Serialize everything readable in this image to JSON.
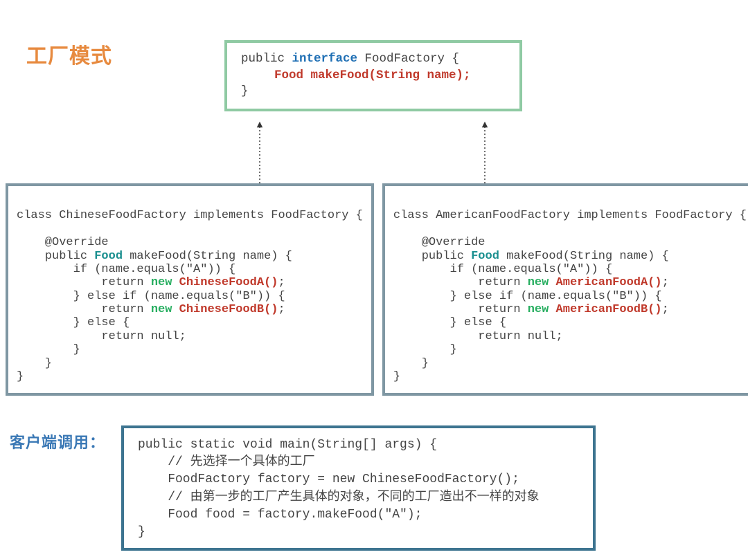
{
  "title": "工厂模式",
  "interface_box": {
    "line1_pre": "public ",
    "line1_kw": "interface",
    "line1_post": " FoodFactory {",
    "line2": "Food makeFood(String name);",
    "line3": "}"
  },
  "impl_left": {
    "l1": "class ChineseFoodFactory implements FoodFactory {",
    "l2": "",
    "l3": "    @Override",
    "l4_pre": "    public ",
    "l4_kw": "Food",
    "l4_post": " makeFood(String name) {",
    "l5": "        if (name.equals(\"A\")) {",
    "l6_pre": "            return ",
    "l6_new": "new ",
    "l6_cls": "ChineseFoodA()",
    "l6_semi": ";",
    "l7": "        } else if (name.equals(\"B\")) {",
    "l8_pre": "            return ",
    "l8_new": "new ",
    "l8_cls": "ChineseFoodB()",
    "l8_semi": ";",
    "l9": "        } else {",
    "l10": "            return null;",
    "l11": "        }",
    "l12": "    }",
    "l13": "}"
  },
  "impl_right": {
    "l1": "class AmericanFoodFactory implements FoodFactory {",
    "l2": "",
    "l3": "    @Override",
    "l4_pre": "    public ",
    "l4_kw": "Food",
    "l4_post": " makeFood(String name) {",
    "l5": "        if (name.equals(\"A\")) {",
    "l6_pre": "            return ",
    "l6_new": "new ",
    "l6_cls": "AmericanFoodA()",
    "l6_semi": ";",
    "l7": "        } else if (name.equals(\"B\")) {",
    "l8_pre": "            return ",
    "l8_new": "new ",
    "l8_cls": "AmericanFoodB()",
    "l8_semi": ";",
    "l9": "        } else {",
    "l10": "            return null;",
    "l11": "        }",
    "l12": "    }",
    "l13": "}"
  },
  "client_label": "客户端调用：",
  "client_box": {
    "l1": "public static void main(String[] args) {",
    "l2": "    // 先选择一个具体的工厂",
    "l3": "    FoodFactory factory = new ChineseFoodFactory();",
    "l4": "    // 由第一步的工厂产生具体的对象，不同的工厂造出不一样的对象",
    "l5": "    Food food = factory.makeFood(\"A\");",
    "l6": "}"
  }
}
